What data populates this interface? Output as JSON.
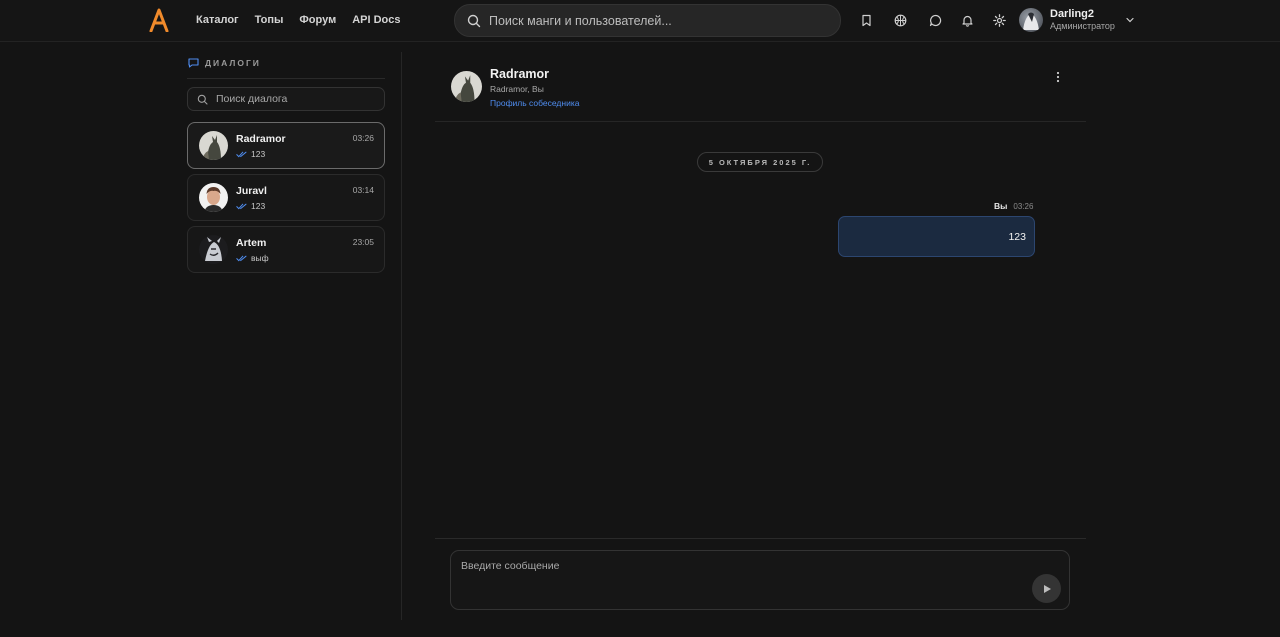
{
  "colors": {
    "accent": "#f08a2b",
    "link": "#4f8df0",
    "bubble": "#1b2a40",
    "bubble_border": "#2c4670",
    "read_check": "#4f8df0"
  },
  "header": {
    "logo_icon": "logo-a-icon",
    "nav": [
      "Каталог",
      "Топы",
      "Форум",
      "API Docs"
    ],
    "search_placeholder": "Поиск манги и пользователей...",
    "icons": [
      "bookmark-icon",
      "basketball-icon",
      "chat-bubble-icon",
      "bell-icon",
      "gear-icon"
    ],
    "user": {
      "name": "Darling2",
      "role": "Администратор"
    }
  },
  "sidebar": {
    "title": "ДИАЛОГИ",
    "search_placeholder": "Поиск диалога",
    "dialogs": [
      {
        "name": "Radramor",
        "time": "03:26",
        "last_message": "123",
        "active": true
      },
      {
        "name": "Juravl",
        "time": "03:14",
        "last_message": "123",
        "active": false
      },
      {
        "name": "Artem",
        "time": "23:05",
        "last_message": "выф",
        "active": false
      }
    ]
  },
  "chat": {
    "name": "Radramor",
    "participants": "Radramor, Вы",
    "profile_link": "Профиль собеседника",
    "date_divider": "5 ОКТЯБРЯ 2025 Г.",
    "messages": [
      {
        "author": "Вы",
        "time": "03:26",
        "text": "123"
      }
    ],
    "composer_placeholder": "Введите сообщение"
  }
}
